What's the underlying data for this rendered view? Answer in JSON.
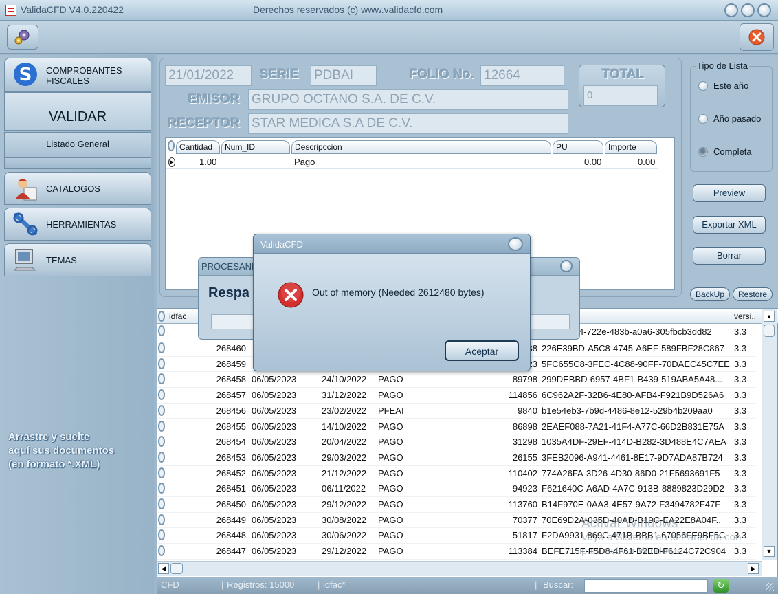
{
  "window": {
    "title": "ValidaCFD V4.0.220422",
    "rights": "Derechos reservados (c) www.validacfd.com"
  },
  "sidebar": {
    "items": [
      {
        "label_line1": "COMPROBANTES",
        "label_line2": "FISCALES"
      },
      {
        "label": "VALIDAR"
      },
      {
        "label": "Listado General"
      },
      {
        "label": "CATALOGOS"
      },
      {
        "label": "HERRAMIENTAS"
      },
      {
        "label": "TEMAS"
      }
    ],
    "drop_hint": [
      "Arrastre y suelte",
      "aquí sus documentos",
      "(en formato *.XML)"
    ]
  },
  "header": {
    "date": "21/01/2022",
    "serie_label": "SERIE",
    "serie": "PDBAI",
    "folio_label": "FOLIO No.",
    "folio": "12664",
    "total_label": "TOTAL",
    "total": "0",
    "emisor_label": "EMISOR",
    "emisor": "GRUPO OCTANO S.A. DE C.V.",
    "receptor_label": "RECEPTOR",
    "receptor": "STAR MEDICA S.A DE C.V."
  },
  "items_grid": {
    "columns": [
      "Cantidad",
      "Num_ID",
      "Descripccion",
      "PU",
      "Importe"
    ],
    "rows": [
      {
        "cantidad": "1.00",
        "num_id": "",
        "descripcion": "Pago",
        "pu": "0.00",
        "importe": "0.00"
      }
    ]
  },
  "tipo_lista": {
    "title": "Tipo de Lista",
    "options": [
      "Este año",
      "Año pasado",
      "Completa"
    ],
    "selected": "Completa"
  },
  "actions": {
    "preview": "Preview",
    "exportar": "Exportar XML",
    "borrar": "Borrar",
    "backup": "BackUp",
    "restore": "Restore"
  },
  "list": {
    "columns": [
      "idfac",
      "versi.."
    ],
    "first_row_uuid": "4-722e-483b-a0a6-305fbcb3dd82",
    "rows": [
      {
        "id": "268460",
        "fecha": "",
        "fecha2": "",
        "tipo": "",
        "num": "88",
        "uuid": "226E39BD-A5C8-4745-A6EF-589FBF28C867",
        "ver": "3.3"
      },
      {
        "id": "268459",
        "fecha": "",
        "fecha2": "",
        "tipo": "",
        "num": "23",
        "uuid": "5FC655C8-3FEC-4C88-90FF-70DAEC45C7EE",
        "ver": "3.3"
      },
      {
        "id": "268458",
        "fecha": "06/05/2023",
        "fecha2": "24/10/2022",
        "tipo": "PAGO",
        "num": "89798",
        "uuid": "299DEBBD-6957-4BF1-B439-519ABA5A48...",
        "ver": "3.3"
      },
      {
        "id": "268457",
        "fecha": "06/05/2023",
        "fecha2": "31/12/2022",
        "tipo": "PAGO",
        "num": "114856",
        "uuid": "6C962A2F-32B6-4E80-AFB4-F921B9D526A6",
        "ver": "3.3"
      },
      {
        "id": "268456",
        "fecha": "06/05/2023",
        "fecha2": "23/02/2022",
        "tipo": "PFEAI",
        "num": "9840",
        "uuid": "b1e54eb3-7b9d-4486-8e12-529b4b209aa0",
        "ver": "3.3"
      },
      {
        "id": "268455",
        "fecha": "06/05/2023",
        "fecha2": "14/10/2022",
        "tipo": "PAGO",
        "num": "86898",
        "uuid": "2EAEF088-7A21-41F4-A77C-66D2B831E75A",
        "ver": "3.3"
      },
      {
        "id": "268454",
        "fecha": "06/05/2023",
        "fecha2": "20/04/2022",
        "tipo": "PAGO",
        "num": "31298",
        "uuid": "1035A4DF-29EF-414D-B282-3D488E4C7AEA",
        "ver": "3.3"
      },
      {
        "id": "268453",
        "fecha": "06/05/2023",
        "fecha2": "29/03/2022",
        "tipo": "PAGO",
        "num": "26155",
        "uuid": "3FEB2096-A941-4461-8E17-9D7ADA87B724",
        "ver": "3.3"
      },
      {
        "id": "268452",
        "fecha": "06/05/2023",
        "fecha2": "21/12/2022",
        "tipo": "PAGO",
        "num": "110402",
        "uuid": "774A26FA-3D26-4D30-86D0-21F5693691F5",
        "ver": "3.3"
      },
      {
        "id": "268451",
        "fecha": "06/05/2023",
        "fecha2": "06/11/2022",
        "tipo": "PAGO",
        "num": "94923",
        "uuid": "F621640C-A6AD-4A7C-913B-8889823D29D2",
        "ver": "3.3"
      },
      {
        "id": "268450",
        "fecha": "06/05/2023",
        "fecha2": "29/12/2022",
        "tipo": "PAGO",
        "num": "113760",
        "uuid": "B14F970E-0AA3-4E57-9A72-F3494782F47F",
        "ver": "3.3"
      },
      {
        "id": "268449",
        "fecha": "06/05/2023",
        "fecha2": "30/08/2022",
        "tipo": "PAGO",
        "num": "70377",
        "uuid": "70E69D2A-035D-40AD-B19C-EA22E8A04F..",
        "ver": "3.3"
      },
      {
        "id": "268448",
        "fecha": "06/05/2023",
        "fecha2": "30/06/2022",
        "tipo": "PAGO",
        "num": "51817",
        "uuid": "F2DA9931-869C-471B-BBB1-67056FE9BF5C",
        "ver": "3.3"
      },
      {
        "id": "268447",
        "fecha": "06/05/2023",
        "fecha2": "29/12/2022",
        "tipo": "PAGO",
        "num": "113384",
        "uuid": "BEFE715F-F5D8-4F61-B2ED-F6124C72C904",
        "ver": "3.3"
      }
    ]
  },
  "statusbar": {
    "cfd": "CFD",
    "registros": "Registros: 15000",
    "sort": "idfac*",
    "buscar": "Buscar:",
    "search_value": ""
  },
  "procesando": {
    "title": "PROCESANDO",
    "body": "Respa"
  },
  "dialog": {
    "title": "ValidaCFD",
    "message": "Out of memory (Needed 2612480 bytes)",
    "button": "Aceptar"
  },
  "watermark": {
    "line1": "Activar Windows",
    "line2": "Vaya a Sistema en el Panel de con",
    "line3": "para activar Windows."
  },
  "colors": {
    "accent": "#a9c1d3",
    "error": "#d32f2f",
    "close_button": "#e85a2a"
  }
}
